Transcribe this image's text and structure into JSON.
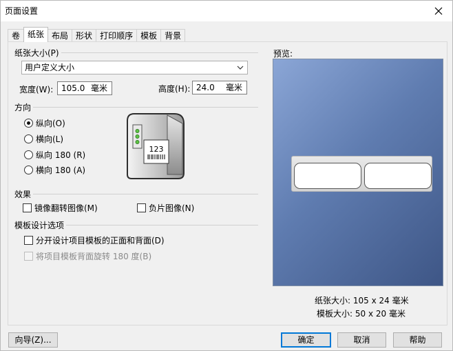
{
  "window": {
    "title": "页面设置"
  },
  "tabs": [
    "卷",
    "纸张",
    "布局",
    "形状",
    "打印顺序",
    "模板",
    "背景"
  ],
  "paper_size": {
    "group_title": "纸张大小(P)",
    "selected": "用户定义大小",
    "width_label": "宽度(W):",
    "width_value": "105.0",
    "width_unit": "毫米",
    "height_label": "高度(H):",
    "height_value": "24.0",
    "height_unit": "毫米"
  },
  "orientation": {
    "group_title": "方向",
    "options": [
      "纵向(O)",
      "横向(L)",
      "纵向 180 (R)",
      "横向 180 (A)"
    ],
    "selected_index": 0,
    "printer_label_text": "123"
  },
  "effects": {
    "group_title": "效果",
    "mirror": "镜像翻转图像(M)",
    "negative": "负片图像(N)"
  },
  "template_options": {
    "group_title": "模板设计选项",
    "separate": "分开设计项目模板的正面和背面(D)",
    "rotate_back": "将项目模板背面旋转 180 度(B)"
  },
  "preview": {
    "label": "预览:",
    "paper_size_text": "纸张大小: 105 x 24 毫米",
    "template_size_text": "模板大小: 50 x 20 毫米"
  },
  "buttons": {
    "wizard": "向导(Z)...",
    "ok": "确定",
    "cancel": "取消",
    "help": "帮助"
  },
  "colors": {
    "accent": "#0078d7",
    "preview_bg": "#5f7cb0"
  }
}
